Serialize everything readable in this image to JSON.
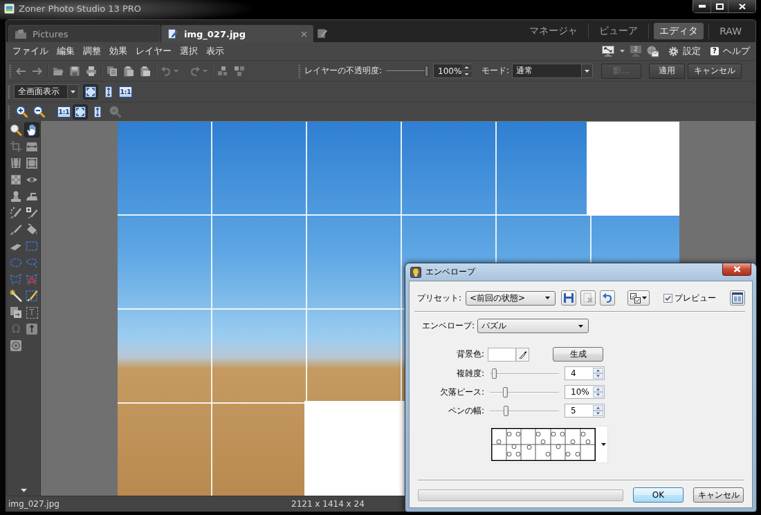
{
  "window": {
    "title": "Zoner Photo Studio 13 PRO"
  },
  "document_tabs": [
    {
      "kind": "browser",
      "label": "Pictures",
      "selected": false
    },
    {
      "kind": "editor",
      "label": "img_027.jpg",
      "selected": true
    }
  ],
  "mode_tabs": [
    {
      "label": "マネージャ",
      "selected": false
    },
    {
      "label": "ビューア",
      "selected": false
    },
    {
      "label": "エディタ",
      "selected": true
    },
    {
      "label": "RAW",
      "selected": false
    }
  ],
  "menu": {
    "items": [
      "ファイル",
      "編集",
      "調整",
      "効果",
      "レイヤー",
      "選択",
      "表示"
    ],
    "display_badge": "2",
    "settings": "設定",
    "help_icon": "?",
    "help": "ヘルプ"
  },
  "layer_toolbar": {
    "opacity_label": "レイヤーの不透明度:",
    "opacity": {
      "level": 1,
      "value": "100%"
    },
    "mode_label": "モード:",
    "mode": "通常",
    "buttons": [
      {
        "label": "影...",
        "disabled": true
      },
      {
        "label": "適用",
        "disabled": false
      },
      {
        "label": "キャンセル",
        "disabled": false
      }
    ]
  },
  "view_toolbar": {
    "zoom_select": "全画面表示",
    "buttons": [
      {
        "kind": "fit",
        "selected": true
      },
      {
        "kind": "fit_height",
        "selected": false
      },
      {
        "kind": "actual_size",
        "label": "1:1",
        "selected": false
      }
    ]
  },
  "zoom_toolbar": [
    {
      "kind": "zoom_in",
      "selected": false,
      "disabled": false
    },
    {
      "kind": "zoom_out",
      "selected": false,
      "disabled": false
    },
    {
      "kind": "actual_size",
      "label": "1:1",
      "selected": false,
      "disabled": false
    },
    {
      "kind": "fit",
      "selected": true,
      "disabled": false
    },
    {
      "kind": "fit_height",
      "selected": false,
      "disabled": false
    },
    {
      "kind": "magnifier",
      "selected": false,
      "disabled": true
    }
  ],
  "tools": [
    {
      "kind": "zoom",
      "selected": false
    },
    {
      "kind": "hand",
      "selected": true
    },
    {
      "kind": "crop",
      "selected": false
    },
    {
      "kind": "straighten",
      "selected": false
    },
    {
      "kind": "perspective",
      "selected": false
    },
    {
      "kind": "transform",
      "selected": false
    },
    {
      "kind": "blur",
      "selected": false
    },
    {
      "kind": "red_eye",
      "selected": false
    },
    {
      "kind": "clone",
      "selected": false
    },
    {
      "kind": "smooth",
      "selected": false
    },
    {
      "kind": "retouch",
      "selected": false
    },
    {
      "kind": "heal",
      "selected": false
    },
    {
      "kind": "brush",
      "selected": false
    },
    {
      "kind": "fill",
      "selected": false
    },
    {
      "kind": "eraser",
      "selected": false
    },
    {
      "kind": "rect_select",
      "selected": false
    },
    {
      "kind": "ellipse_select",
      "selected": false
    },
    {
      "kind": "lasso",
      "selected": false
    },
    {
      "kind": "polygon_lasso",
      "selected": false
    },
    {
      "kind": "magnetic_lasso",
      "selected": false
    },
    {
      "kind": "magic_wand",
      "selected": false
    },
    {
      "kind": "selection_brush",
      "selected": false
    },
    {
      "kind": "paste_layer",
      "selected": false
    },
    {
      "kind": "text_select",
      "glyph": "T",
      "selected": false
    },
    {
      "kind": "symbol",
      "glyph": "Ω",
      "selected": false
    },
    {
      "kind": "arrow",
      "selected": false
    },
    {
      "kind": "target",
      "selected": false
    }
  ],
  "status_bar": {
    "file": "img_027.jpg",
    "dimensions": "2121 x 1414 x 24"
  },
  "dialog": {
    "title": "エンベロープ",
    "preset_label": "プリセット:",
    "preset": "<前回の状態>",
    "preview": {
      "label": "プレビュー",
      "checked": true
    },
    "envelope_label": "エンベロープ:",
    "envelope": "パズル",
    "background": {
      "label": "背景色:",
      "color": "#ffffff"
    },
    "generate": "生成",
    "params": [
      {
        "label": "複雑度:",
        "level": 0.03,
        "value": "4"
      },
      {
        "label": "欠落ピース:",
        "level": 0.2,
        "value": "10%"
      },
      {
        "label": "ペンの幅:",
        "level": 0.22,
        "value": "5"
      }
    ],
    "progress": {
      "level": 0
    },
    "buttons": [
      {
        "label": "OK",
        "default": true
      },
      {
        "label": "キャンセル",
        "default": false
      }
    ]
  }
}
